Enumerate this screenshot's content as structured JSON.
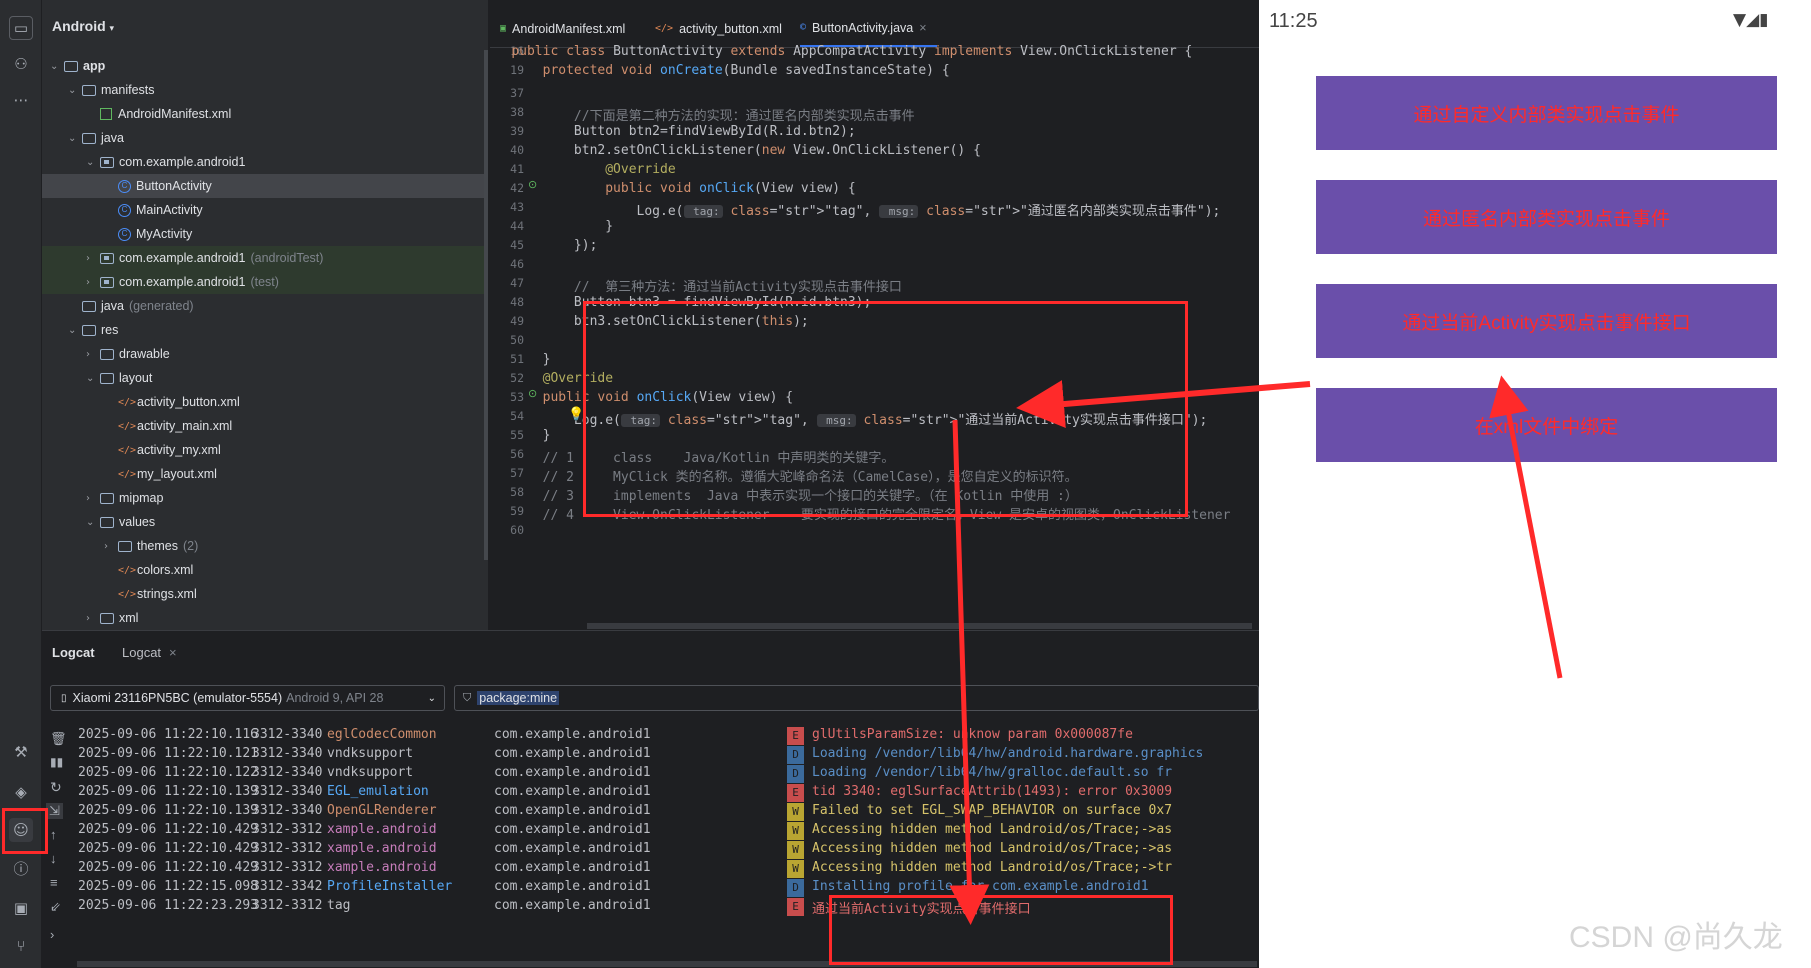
{
  "project": {
    "title": "Android",
    "tree": [
      {
        "label": "app",
        "kind": "module",
        "depth": 0,
        "open": true
      },
      {
        "label": "manifests",
        "kind": "folder",
        "depth": 1,
        "open": true
      },
      {
        "label": "AndroidManifest.xml",
        "kind": "manifest",
        "depth": 2
      },
      {
        "label": "java",
        "kind": "folder",
        "depth": 1,
        "open": true
      },
      {
        "label": "com.example.android1",
        "kind": "package",
        "depth": 2,
        "open": true
      },
      {
        "label": "ButtonActivity",
        "kind": "class",
        "depth": 3,
        "selected": true
      },
      {
        "label": "MainActivity",
        "kind": "class",
        "depth": 3
      },
      {
        "label": "MyActivity",
        "kind": "class",
        "depth": 3
      },
      {
        "label": "com.example.android1",
        "hint": "(androidTest)",
        "kind": "package",
        "depth": 2,
        "collapsed": true,
        "tinted": true
      },
      {
        "label": "com.example.android1",
        "hint": "(test)",
        "kind": "package",
        "depth": 2,
        "collapsed": true,
        "tinted": true
      },
      {
        "label": "java",
        "hint": "(generated)",
        "kind": "folder",
        "depth": 1
      },
      {
        "label": "res",
        "kind": "folder",
        "depth": 1,
        "open": true
      },
      {
        "label": "drawable",
        "kind": "folder",
        "depth": 2,
        "collapsed": true
      },
      {
        "label": "layout",
        "kind": "folder",
        "depth": 2,
        "open": true
      },
      {
        "label": "activity_button.xml",
        "kind": "xml",
        "depth": 3
      },
      {
        "label": "activity_main.xml",
        "kind": "xml",
        "depth": 3
      },
      {
        "label": "activity_my.xml",
        "kind": "xml",
        "depth": 3
      },
      {
        "label": "my_layout.xml",
        "kind": "xml",
        "depth": 3
      },
      {
        "label": "mipmap",
        "kind": "folder",
        "depth": 2,
        "collapsed": true
      },
      {
        "label": "values",
        "kind": "folder",
        "depth": 2,
        "open": true
      },
      {
        "label": "themes",
        "hint": "(2)",
        "kind": "folder",
        "depth": 3,
        "collapsed": true
      },
      {
        "label": "colors.xml",
        "kind": "xml",
        "depth": 3
      },
      {
        "label": "strings.xml",
        "kind": "xml",
        "depth": 3
      },
      {
        "label": "xml",
        "kind": "folder",
        "depth": 2,
        "collapsed": true
      }
    ]
  },
  "editor": {
    "tabs": [
      {
        "label": "AndroidManifest.xml",
        "icon": "manifest-icon"
      },
      {
        "label": "activity_button.xml",
        "icon": "xml-icon"
      },
      {
        "label": "ButtonActivity.java",
        "icon": "class-icon",
        "active": true,
        "closable": true
      }
    ],
    "lines": [
      {
        "n": "16",
        "t": "    public class ButtonActivity extends AppCompatActivity implements View.OnClickListener {"
      },
      {
        "n": "19",
        "t": "        protected void onCreate(Bundle savedInstanceState) {"
      },
      {
        "n": "37",
        "t": ""
      },
      {
        "n": "38",
        "t": "            //下面是第二种方法的实现：通过匿名内部类实现点击事件"
      },
      {
        "n": "39",
        "t": "            Button btn2=findViewById(R.id.btn2);"
      },
      {
        "n": "40",
        "t": "            btn2.setOnClickListener(new View.OnClickListener() {"
      },
      {
        "n": "41",
        "t": "                @Override"
      },
      {
        "n": "42",
        "t": "                public void onClick(View view) {"
      },
      {
        "n": "43",
        "t": "                    Log.e( tag: \"tag\",  msg: \"通过匿名内部类实现点击事件\");"
      },
      {
        "n": "44",
        "t": "                }"
      },
      {
        "n": "45",
        "t": "            });"
      },
      {
        "n": "46",
        "t": ""
      },
      {
        "n": "47",
        "t": "            //  第三种方法：通过当前Activity实现点击事件接口"
      },
      {
        "n": "48",
        "t": "            Button btn3 = findViewById(R.id.btn3);"
      },
      {
        "n": "49",
        "t": "            btn3.setOnClickListener(this);"
      },
      {
        "n": "50",
        "t": ""
      },
      {
        "n": "51",
        "t": "        }"
      },
      {
        "n": "52",
        "t": "        @Override"
      },
      {
        "n": "53",
        "t": "        public void onClick(View view) {"
      },
      {
        "n": "54",
        "t": "            Log.e( tag: \"tag\",  msg: \"通过当前Activity实现点击事件接口\");"
      },
      {
        "n": "55",
        "t": "        }"
      },
      {
        "n": "56",
        "t": "        // 1     class    Java/Kotlin 中声明类的关键字。"
      },
      {
        "n": "57",
        "t": "        // 2     MyClick 类的名称。遵循大驼峰命名法（CamelCase），是您自定义的标识符。"
      },
      {
        "n": "58",
        "t": "        // 3     implements  Java 中表示实现一个接口的关键字。（在 Kotlin 中使用 :）"
      },
      {
        "n": "59",
        "t": "        // 4     View.OnClickListener    要实现的接口的完全限定名。View 是安卓的视图类，OnClickListener"
      },
      {
        "n": "60",
        "t": ""
      }
    ]
  },
  "logcat": {
    "tabs": [
      "Logcat",
      "Logcat"
    ],
    "device": "Xiaomi 23116PN5BC (emulator-5554)",
    "device_hint": "Android 9, API 28",
    "filter": "package:mine",
    "rows": [
      {
        "ts": "2025-09-06 11:22:10.116",
        "pid": "3312-3340",
        "tag": "eglCodecCommon",
        "tagc": "#cf8e6d",
        "pkg": "com.example.android1",
        "lvl": "E",
        "msg": "glUtilsParamSize: unknow param 0x000087fe"
      },
      {
        "ts": "2025-09-06 11:22:10.121",
        "pid": "3312-3340",
        "tag": "vndksupport",
        "tagc": "#bcbec4",
        "pkg": "com.example.android1",
        "lvl": "D",
        "msg": "Loading /vendor/lib64/hw/android.hardware.graphics"
      },
      {
        "ts": "2025-09-06 11:22:10.122",
        "pid": "3312-3340",
        "tag": "vndksupport",
        "tagc": "#bcbec4",
        "pkg": "com.example.android1",
        "lvl": "D",
        "msg": "Loading /vendor/lib64/hw/gralloc.default.so fr"
      },
      {
        "ts": "2025-09-06 11:22:10.139",
        "pid": "3312-3340",
        "tag": "EGL_emulation",
        "tagc": "#56a8f5",
        "pkg": "com.example.android1",
        "lvl": "E",
        "msg": "tid 3340: eglSurfaceAttrib(1493): error 0x3009"
      },
      {
        "ts": "2025-09-06 11:22:10.139",
        "pid": "3312-3340",
        "tag": "OpenGLRenderer",
        "tagc": "#cf8e6d",
        "pkg": "com.example.android1",
        "lvl": "W",
        "msg": "Failed to set EGL_SWAP_BEHAVIOR on surface 0x7"
      },
      {
        "ts": "2025-09-06 11:22:10.429",
        "pid": "3312-3312",
        "tag": "xample.android",
        "tagc": "#c77dbb",
        "pkg": "com.example.android1",
        "lvl": "W",
        "msg": "Accessing hidden method Landroid/os/Trace;->as"
      },
      {
        "ts": "2025-09-06 11:22:10.429",
        "pid": "3312-3312",
        "tag": "xample.android",
        "tagc": "#c77dbb",
        "pkg": "com.example.android1",
        "lvl": "W",
        "msg": "Accessing hidden method Landroid/os/Trace;->as"
      },
      {
        "ts": "2025-09-06 11:22:10.429",
        "pid": "3312-3312",
        "tag": "xample.android",
        "tagc": "#c77dbb",
        "pkg": "com.example.android1",
        "lvl": "W",
        "msg": "Accessing hidden method Landroid/os/Trace;->tr"
      },
      {
        "ts": "2025-09-06 11:22:15.098",
        "pid": "3312-3342",
        "tag": "ProfileInstaller",
        "tagc": "#56a8f5",
        "pkg": "com.example.android1",
        "lvl": "D",
        "msg": "Installing profile for com.example.android1"
      },
      {
        "ts": "2025-09-06 11:22:23.293",
        "pid": "3312-3312",
        "tag": "tag",
        "tagc": "#bcbec4",
        "pkg": "com.example.android1",
        "lvl": "E",
        "msg": "通过当前Activity实现点击事件接口"
      }
    ]
  },
  "phone": {
    "time": "11:25",
    "buttons": [
      "通过自定义内部类实现点击事件",
      "通过匿名内部类实现点击事件",
      "通过当前Activity实现点击事件接口",
      "在xml文件中绑定"
    ],
    "watermark": "CSDN @尚久龙"
  },
  "colors": {
    "accent": "#3574f0",
    "button_bg": "#6a4faa",
    "annotation_red": "#ff2a2a"
  }
}
